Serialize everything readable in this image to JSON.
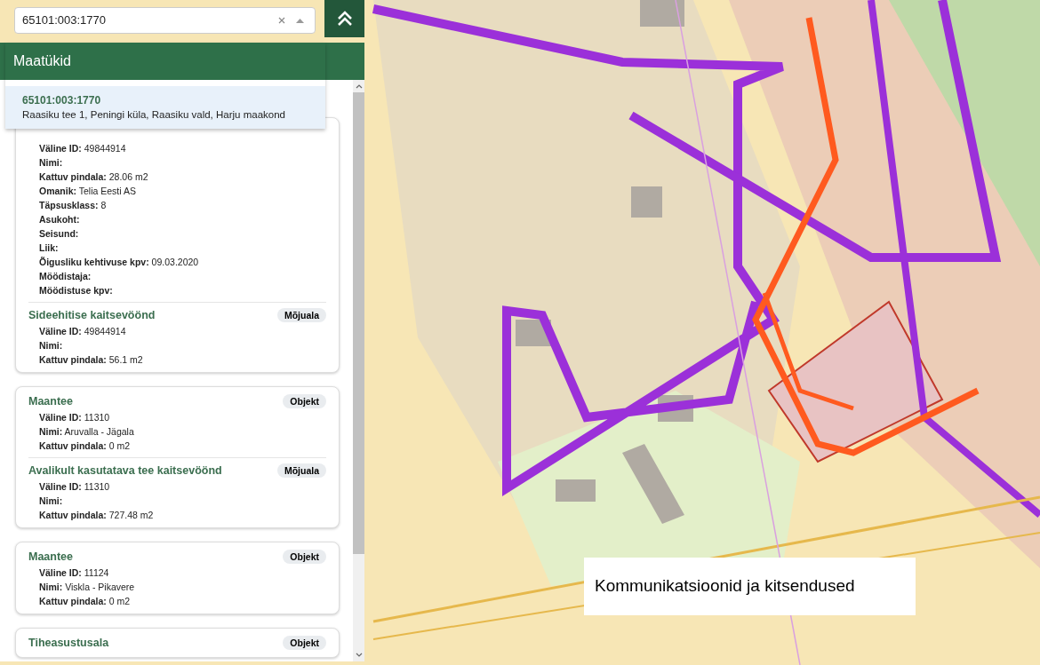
{
  "search": {
    "value": "65101:003:1770"
  },
  "dropdown": {
    "header": "Maatükid",
    "results": [
      {
        "id": "65101:003:1770",
        "address": "Raasiku tee 1, Peningi küla, Raasiku vald, Harju maakond",
        "selected": true
      }
    ]
  },
  "cards": [
    {
      "sections": [
        {
          "fields": [
            {
              "label": "Väline ID:",
              "value": "49844914"
            },
            {
              "label": "Nimi:"
            },
            {
              "label": "Kattuv pindala:",
              "value": "28.06 m2"
            },
            {
              "label": "Omanik:",
              "value": "Telia Eesti AS"
            },
            {
              "label": "Täpsusklass:",
              "value": "8"
            },
            {
              "label": "Asukoht:"
            },
            {
              "label": "Seisund:"
            },
            {
              "label": "Liik:"
            },
            {
              "label": "Õigusliku kehtivuse kpv:",
              "value": "09.03.2020"
            },
            {
              "label": "Möödistaja:"
            },
            {
              "label": "Möödistuse kpv:"
            }
          ]
        },
        {
          "title": "Sideehitise kaitsevöönd",
          "badge": "Mõjuala",
          "fields": [
            {
              "label": "Väline ID:",
              "value": "49844914"
            },
            {
              "label": "Nimi:"
            },
            {
              "label": "Kattuv pindala:",
              "value": "56.1 m2"
            }
          ]
        }
      ]
    },
    {
      "sections": [
        {
          "title": "Maantee",
          "badge": "Objekt",
          "fields": [
            {
              "label": "Väline ID:",
              "value": "11310"
            },
            {
              "label": "Nimi:",
              "value": "Aruvalla - Jägala"
            },
            {
              "label": "Kattuv pindala:",
              "value": "0 m2"
            }
          ]
        },
        {
          "title": "Avalikult kasutatava tee kaitsevöönd",
          "badge": "Mõjuala",
          "fields": [
            {
              "label": "Väline ID:",
              "value": "11310"
            },
            {
              "label": "Nimi:"
            },
            {
              "label": "Kattuv pindala:",
              "value": "727.48 m2"
            }
          ]
        }
      ]
    },
    {
      "sections": [
        {
          "title": "Maantee",
          "badge": "Objekt",
          "fields": [
            {
              "label": "Väline ID:",
              "value": "11124"
            },
            {
              "label": "Nimi:",
              "value": "Viskla - Pikavere"
            },
            {
              "label": "Kattuv pindala:",
              "value": "0 m2"
            }
          ]
        }
      ]
    },
    {
      "sections": [
        {
          "title": "Tiheasustusala",
          "badge": "Objekt"
        }
      ]
    }
  ],
  "caption": "Kommunikatsioonid ja kitsendused"
}
